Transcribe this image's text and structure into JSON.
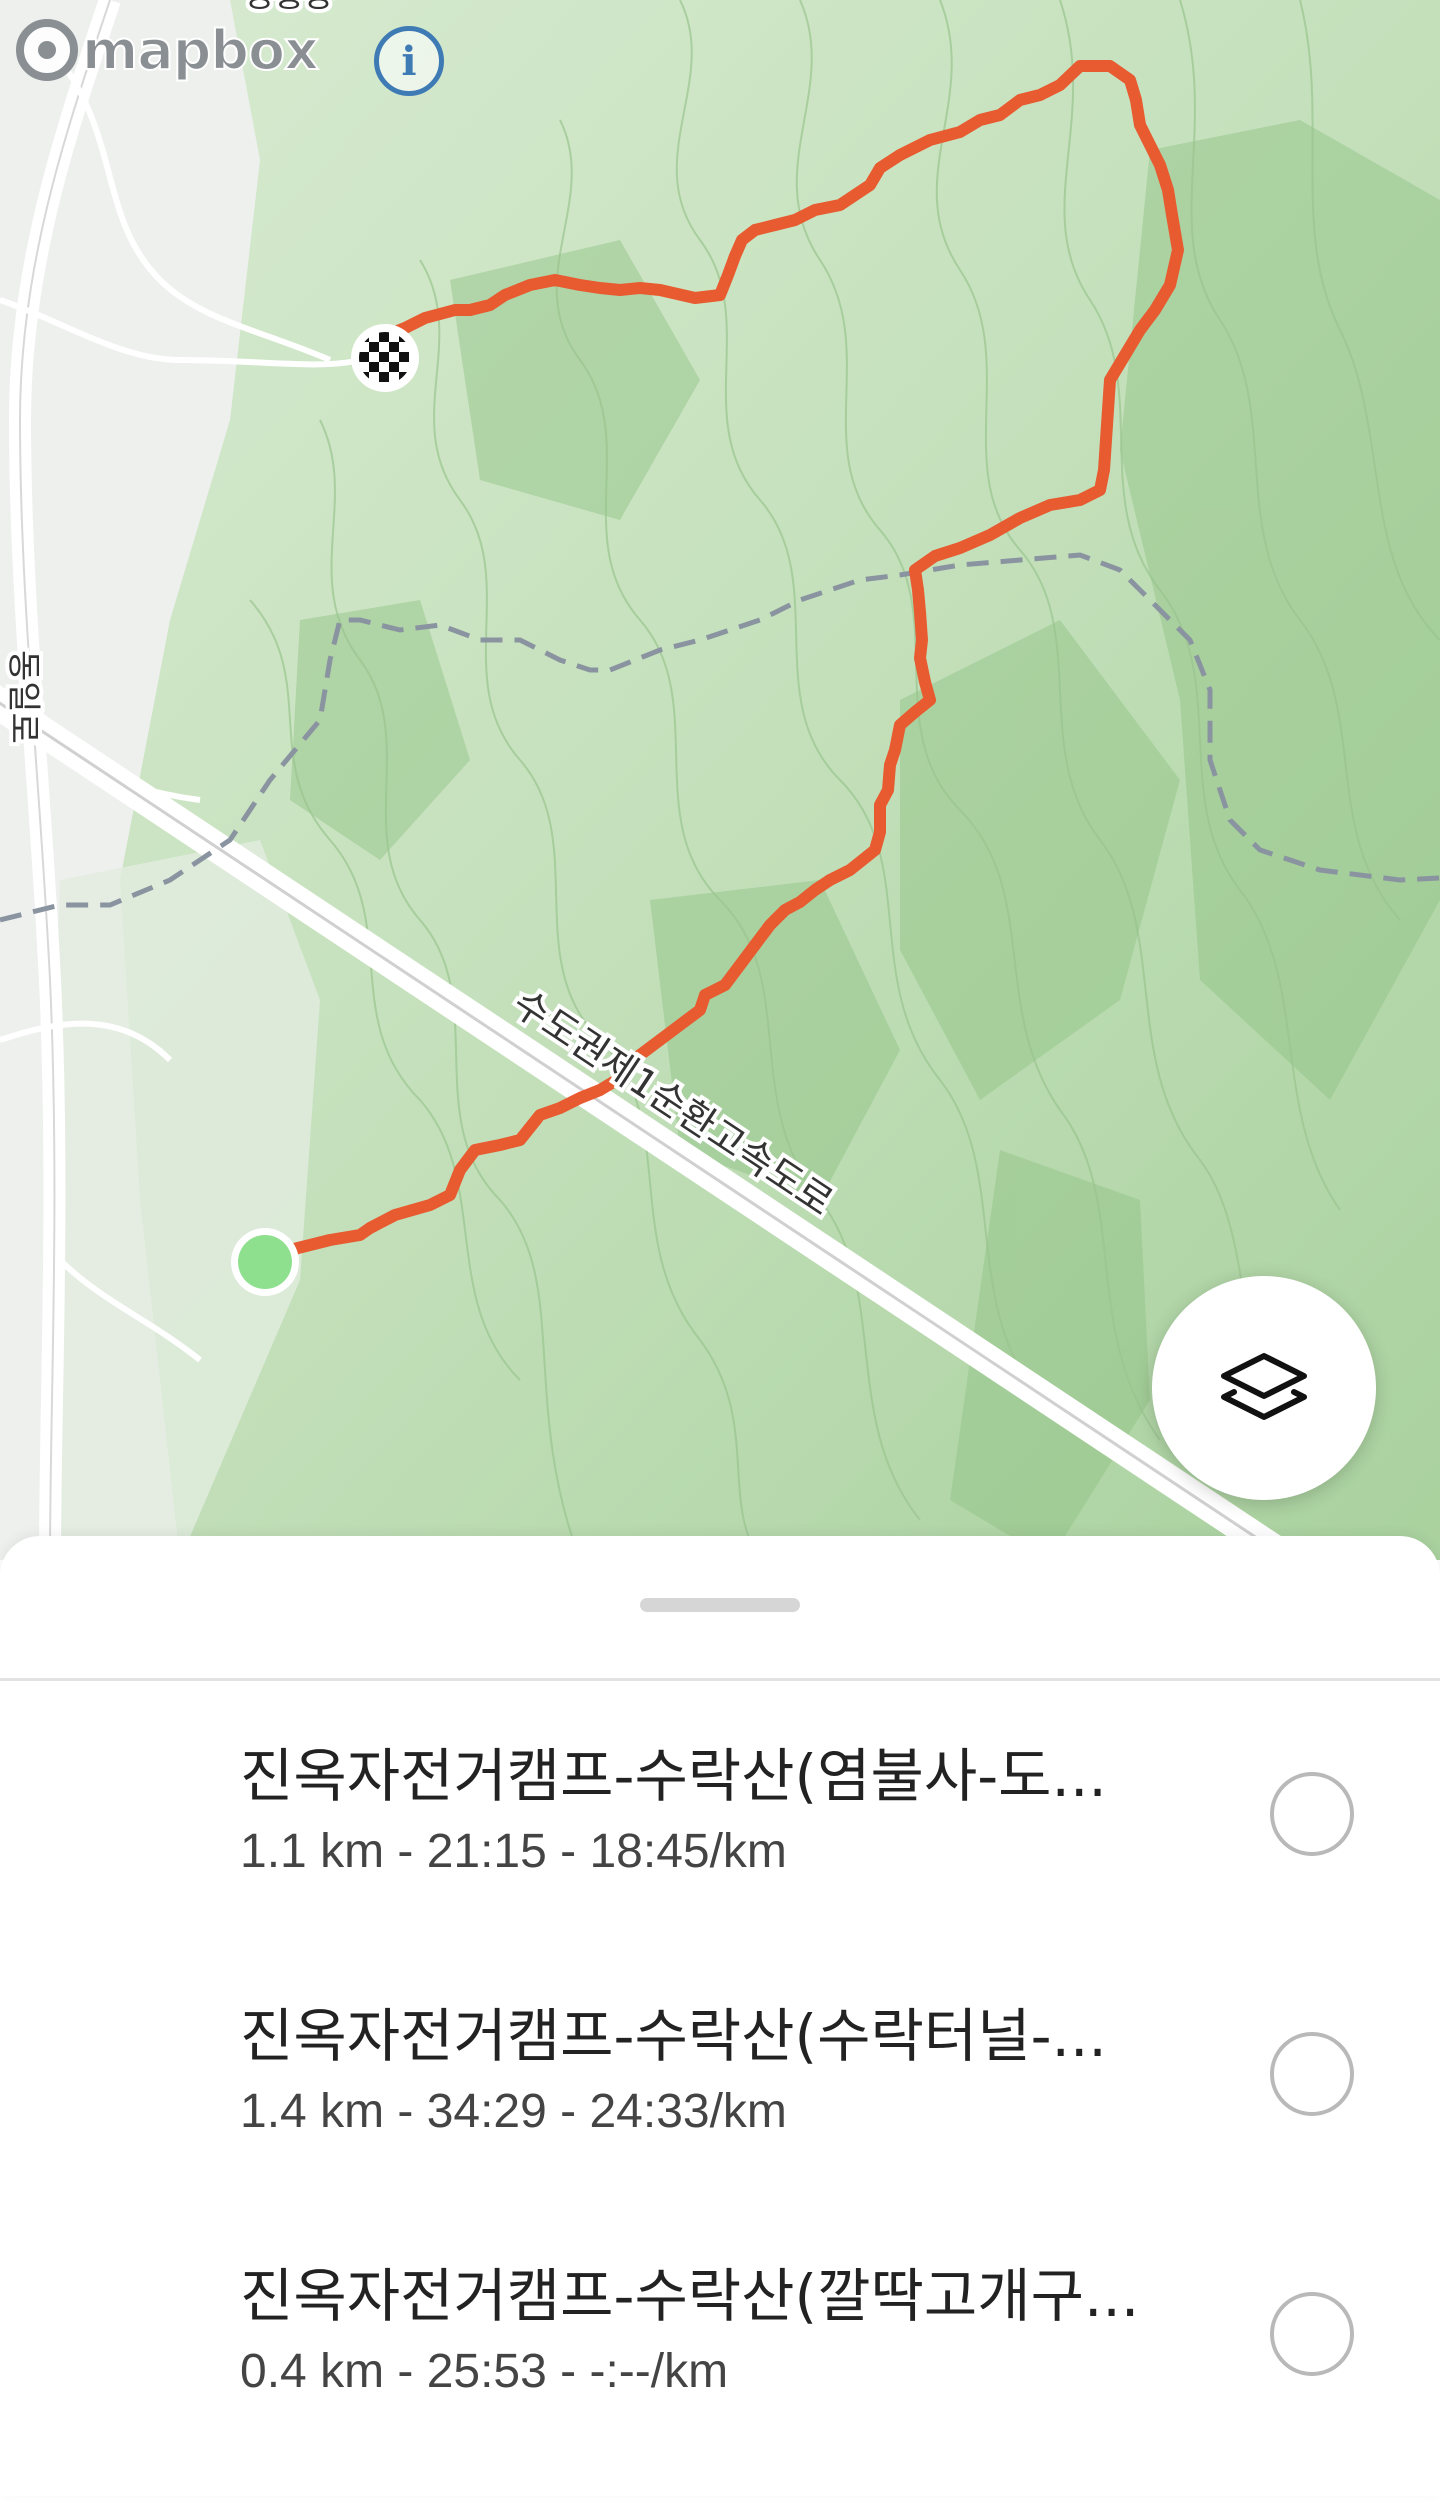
{
  "map": {
    "attribution": {
      "logo_text": "mapbox",
      "info_icon": "info-icon"
    },
    "road_labels": {
      "expressway": "수도권제1순환고속도로",
      "local_road": "동일로",
      "top_label": "공릉동"
    },
    "route_color": "#e85a2f",
    "trail_color": "#8a94a0",
    "start_marker": {
      "color": "#8ee08e",
      "icon": "start-circle"
    },
    "finish_marker": {
      "icon": "checkered-flag-icon"
    },
    "layers_button": {
      "icon": "layers-icon"
    }
  },
  "sheet": {
    "routes": [
      {
        "title": "진옥자전거캠프-수락산(염불사-도...",
        "stats": "1.1 km - 21:15 - 18:45/km",
        "selected": false
      },
      {
        "title": "진옥자전거캠프-수락산(수락터널-...",
        "stats": "1.4 km - 34:29 - 24:33/km",
        "selected": false
      },
      {
        "title": "진옥자전거캠프-수락산(깔딱고개구...",
        "stats": "0.4 km - 25:53 - -:--/km",
        "selected": false
      }
    ]
  }
}
